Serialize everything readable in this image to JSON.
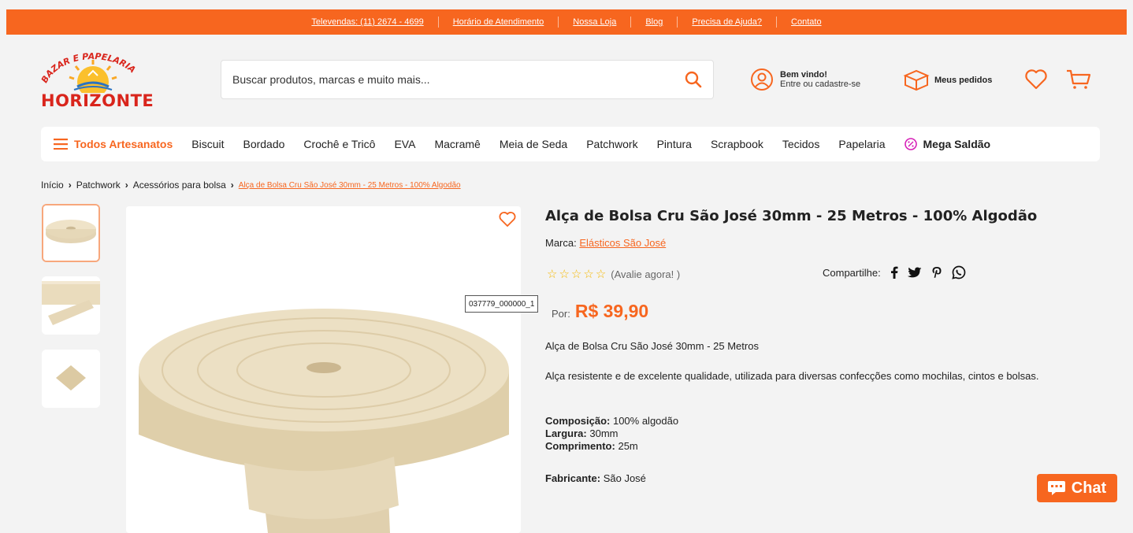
{
  "topbar": {
    "links": [
      "Televendas: (11) 2674 - 4699",
      "Horário de Atendimento",
      "Nossa Loja",
      "Blog",
      "Precisa de Ajuda?",
      "Contato"
    ]
  },
  "logo": {
    "arc_text": "BAZAR E PAPELARIA",
    "name": "HORIZONTE"
  },
  "search": {
    "placeholder": "Buscar produtos, marcas e muito mais..."
  },
  "account": {
    "greeting": "Bem vindo!",
    "action": "Entre ou cadastre-se"
  },
  "orders": {
    "label": "Meus pedidos"
  },
  "nav": {
    "all_label": "Todos Artesanatos",
    "items": [
      "Biscuit",
      "Bordado",
      "Crochê e Tricô",
      "EVA",
      "Macramê",
      "Meia de Seda",
      "Patchwork",
      "Pintura",
      "Scrapbook",
      "Tecidos",
      "Papelaria"
    ],
    "mega_label": "Mega Saldão"
  },
  "breadcrumb": {
    "items": [
      "Início",
      "Patchwork",
      "Acessórios para bolsa"
    ],
    "current": "Alça de Bolsa Cru São José 30mm - 25 Metros - 100% Algodão"
  },
  "tooltip": "037779_000000_1",
  "product": {
    "title": "Alça de Bolsa Cru São José 30mm - 25 Metros - 100% Algodão",
    "brand_label": "Marca:",
    "brand": "Elásticos São José",
    "rating_stars": 0,
    "rating_text": "(Avalie agora! )",
    "share_label": "Compartilhe:",
    "price_prefix": "Por:",
    "price": "R$ 39,90",
    "short_desc": "Alça de Bolsa Cru São José 30mm - 25 Metros",
    "long_desc": "Alça resistente e de excelente qualidade, utilizada para diversas confecções como mochilas, cintos e bolsas.",
    "spec_composition_label": "Composição:",
    "spec_composition": "100% algodão",
    "spec_width_label": "Largura:",
    "spec_width": "30mm",
    "spec_length_label": "Comprimento:",
    "spec_length": "25m",
    "manufacturer_label": "Fabricante:",
    "manufacturer": "São José"
  },
  "chat": {
    "label": "Chat"
  },
  "colors": {
    "accent": "#f7661f",
    "logo_red": "#d9251c",
    "star": "#f5b800",
    "beige": "#e9dcc0"
  }
}
